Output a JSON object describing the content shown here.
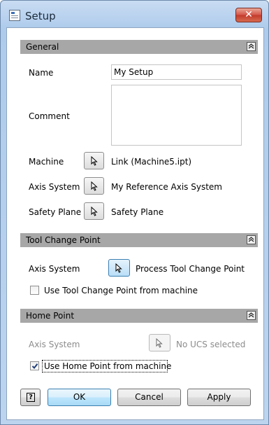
{
  "window": {
    "title": "Setup",
    "close_glyph": "✕"
  },
  "general": {
    "header": "General",
    "name_label": "Name",
    "name_value": "My Setup",
    "comment_label": "Comment",
    "comment_value": "",
    "machine_label": "Machine",
    "machine_value": "Link (Machine5.ipt)",
    "axis_label": "Axis System",
    "axis_value": "My Reference Axis System",
    "safety_label": "Safety Plane",
    "safety_value": "Safety Plane"
  },
  "tool_change": {
    "header": "Tool Change Point",
    "axis_label": "Axis System",
    "axis_value": "Process Tool Change Point",
    "checkbox_label": "Use Tool Change Point from machine",
    "checkbox_checked": false
  },
  "home_point": {
    "header": "Home Point",
    "axis_label": "Axis System",
    "axis_value": "No UCS selected",
    "checkbox_label": "Use Home Point from machine",
    "checkbox_checked": true
  },
  "footer": {
    "help_glyph": "?",
    "ok_label": "OK",
    "cancel_label": "Cancel",
    "apply_label": "Apply"
  },
  "icons": {
    "collapse": "chevron-up-icon",
    "pick": "cursor-arrow-icon",
    "check": "check-icon",
    "help": "help-icon"
  },
  "colors": {
    "section_header": "#a7a7a7",
    "close_button": "#c13b2c",
    "active_button": "#b9def7",
    "disabled_text": "#8c8c8c"
  }
}
